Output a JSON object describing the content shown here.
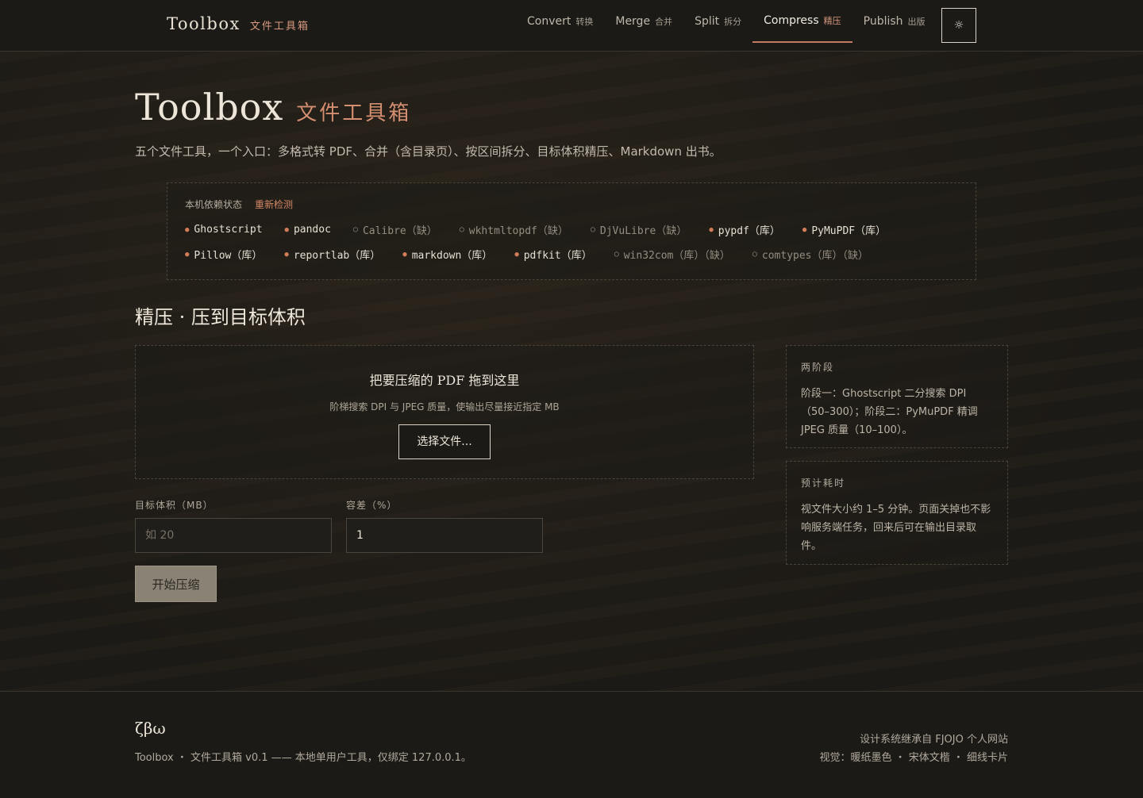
{
  "header": {
    "brand_name": "Toolbox",
    "brand_sub": "文件工具箱",
    "nav": [
      {
        "label": "Convert",
        "zh": "转换"
      },
      {
        "label": "Merge",
        "zh": "合并"
      },
      {
        "label": "Split",
        "zh": "拆分"
      },
      {
        "label": "Compress",
        "zh": "精压"
      },
      {
        "label": "Publish",
        "zh": "出版"
      }
    ],
    "active_nav": "Compress",
    "theme_icon": "☼"
  },
  "hero": {
    "title": "Toolbox",
    "subtitle": "文件工具箱",
    "desc": "五个文件工具，一个入口：多格式转 PDF、合并（含目录页）、按区间拆分、目标体积精压、Markdown 出书。"
  },
  "deps": {
    "title": "本机依赖状态",
    "recheck": "重新检测",
    "row1": [
      {
        "name": "Ghostscript",
        "ok": true
      },
      {
        "name": "pandoc",
        "ok": true
      },
      {
        "name": "Calibre（缺）",
        "ok": false
      },
      {
        "name": "wkhtmltopdf（缺）",
        "ok": false
      },
      {
        "name": "DjVuLibre（缺）",
        "ok": false
      },
      {
        "name": "pypdf（库）",
        "ok": true
      },
      {
        "name": "PyMuPDF（库）",
        "ok": true
      }
    ],
    "row2": [
      {
        "name": "Pillow（库）",
        "ok": true
      },
      {
        "name": "reportlab（库）",
        "ok": true
      },
      {
        "name": "markdown（库）",
        "ok": true
      },
      {
        "name": "pdfkit（库）",
        "ok": true
      },
      {
        "name": "win32com（库）（缺）",
        "ok": false
      },
      {
        "name": "comtypes（库）（缺）",
        "ok": false
      }
    ]
  },
  "compress": {
    "section_title": "精压 · 压到目标体积",
    "drop_title": "把要压缩的 PDF 拖到这里",
    "drop_sub": "阶梯搜索 DPI 与 JPEG 质量，使输出尽量接近指定 MB",
    "choose_button": "选择文件...",
    "target_label": "目标体积（MB）",
    "target_placeholder": "如 20",
    "tolerance_label": "容差（%）",
    "tolerance_value": "1",
    "submit": "开始压缩"
  },
  "side": {
    "stages_title": "两阶段",
    "stages_text": "阶段一：Ghostscript 二分搜索 DPI（50–300）；阶段二：PyMuPDF 精调 JPEG 质量（10–100）。",
    "time_title": "预计耗时",
    "time_text": "视文件大小约 1–5 分钟。页面关掉也不影响服务端任务，回来后可在输出目录取件。"
  },
  "footer": {
    "logo": "ζβω",
    "left": "Toolbox ・ 文件工具箱 v0.1 —— 本地单用户工具，仅绑定 127.0.0.1。",
    "right1": "设计系统继承自 FJOJO 个人网站",
    "right2": "视觉：暖纸墨色 ・ 宋体文楷 ・ 细线卡片"
  },
  "colors": {
    "background": "#1b1915",
    "accent": "#d38f70",
    "ok_dot": "#d27d58",
    "missing_dot": "#8f877a"
  }
}
